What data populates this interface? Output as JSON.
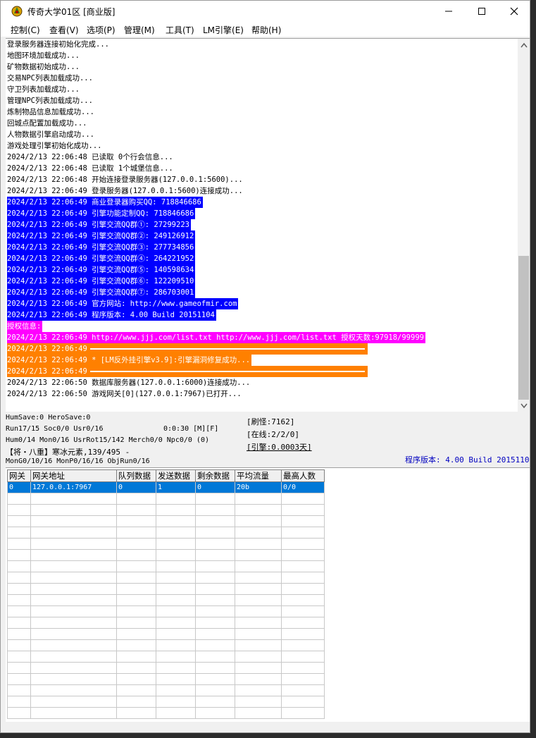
{
  "window": {
    "title": "传奇大学01区 [商业版]",
    "controls": {
      "minimize": "—",
      "maximize": "☐",
      "close": "✕"
    }
  },
  "menu": [
    "控制(C)",
    "查看(V)",
    "选项(P)",
    "管理(M)",
    "工具(T)",
    "LM引擎(E)",
    "帮助(H)"
  ],
  "log": [
    {
      "text": "登录服务器连接初始化完成...",
      "style": "plain"
    },
    {
      "text": "地图环境加载成功...",
      "style": "plain"
    },
    {
      "text": "矿物数据初始成功...",
      "style": "plain"
    },
    {
      "text": "交易NPC列表加载成功...",
      "style": "plain"
    },
    {
      "text": "守卫列表加载成功...",
      "style": "plain"
    },
    {
      "text": "管理NPC列表加载成功...",
      "style": "plain"
    },
    {
      "text": "炼制物品信息加载成功...",
      "style": "plain"
    },
    {
      "text": "回城点配置加载成功...",
      "style": "plain"
    },
    {
      "text": "人物数据引擎启动成功...",
      "style": "plain"
    },
    {
      "text": "游戏处理引擎初始化成功...",
      "style": "plain"
    },
    {
      "text": "2024/2/13 22:06:48 已读取 0个行会信息...",
      "style": "plain"
    },
    {
      "text": "2024/2/13 22:06:48 已读取 1个城堡信息...",
      "style": "plain"
    },
    {
      "text": "2024/2/13 22:06:48 开始连接登录服务器(127.0.0.1:5600)...",
      "style": "plain"
    },
    {
      "text": "2024/2/13 22:06:49 登录服务器(127.0.0.1:5600)连接成功...",
      "style": "plain"
    },
    {
      "text": "2024/2/13 22:06:49 商业登录器购买QQ: 718846686",
      "style": "blue"
    },
    {
      "text": "2024/2/13 22:06:49 引擎功能定制QQ: 718846686",
      "style": "blue"
    },
    {
      "text": "2024/2/13 22:06:49 引擎交流QQ群①: 27299223",
      "style": "blue"
    },
    {
      "text": "2024/2/13 22:06:49 引擎交流QQ群②: 249126912",
      "style": "blue"
    },
    {
      "text": "2024/2/13 22:06:49 引擎交流QQ群③: 277734856",
      "style": "blue"
    },
    {
      "text": "2024/2/13 22:06:49 引擎交流QQ群④: 264221952",
      "style": "blue"
    },
    {
      "text": "2024/2/13 22:06:49 引擎交流QQ群⑤: 140598634",
      "style": "blue"
    },
    {
      "text": "2024/2/13 22:06:49 引擎交流QQ群⑥: 122209510",
      "style": "blue"
    },
    {
      "text": "2024/2/13 22:06:49 引擎交流QQ群⑦: 286703001",
      "style": "blue"
    },
    {
      "text": "2024/2/13 22:06:49 官方网站: http://www.gameofmir.com",
      "style": "blue"
    },
    {
      "text": "2024/2/13 22:06:49 程序版本: 4.00 Build 20151104",
      "style": "blue"
    },
    {
      "text": "授权信息:",
      "style": "magenta"
    },
    {
      "text": "2024/2/13 22:06:49 http://www.jjj.com/list.txt http://www.jjj.com/list.txt 授权天数:97918/99999",
      "style": "magenta"
    },
    {
      "text": "2024/2/13 22:06:49 ",
      "style": "orange-rule"
    },
    {
      "text": "2024/2/13 22:06:49 * [LM反外挂引擎v3.9]:引擎漏洞修复成功...",
      "style": "orange"
    },
    {
      "text": "2024/2/13 22:06:49 ",
      "style": "orange-rule"
    },
    {
      "text": "2024/2/13 22:06:50 数据库服务器(127.0.0.1:6000)连接成功...",
      "style": "plain"
    },
    {
      "text": "2024/2/13 22:06:50 游戏网关[0](127.0.0.1:7967)已打开...",
      "style": "plain"
    }
  ],
  "status": {
    "line1": "HumSave:0 HeroSave:0",
    "line2a": "Run17/15 Soc0/0 Usr0/16",
    "line2b": "0:0:30 [M][F]",
    "line3": "Hum0/14 Mon0/16 UsrRot15/142 Merch0/0 Npc0/0 (0)",
    "line4": "【将・八重】寒冰元素,139/495 -",
    "line5": "MonG0/10/16 MonP0/16/16 ObjRun0/16",
    "monster_refresh": "[刷怪:7162]",
    "online": "[在线:2/2/0]",
    "engine": "[引擎:0.0003天]",
    "version": "程序版本: 4.00 Build 20151104"
  },
  "grid": {
    "headers": [
      "网关",
      "网关地址",
      "队列数据",
      "发送数据",
      "剩余数据",
      "平均流量",
      "最高人数"
    ],
    "rows": [
      [
        "0",
        "127.0.0.1:7967",
        "0",
        "1",
        "0",
        "20b",
        "0/0"
      ]
    ],
    "empty_rows": 20
  }
}
